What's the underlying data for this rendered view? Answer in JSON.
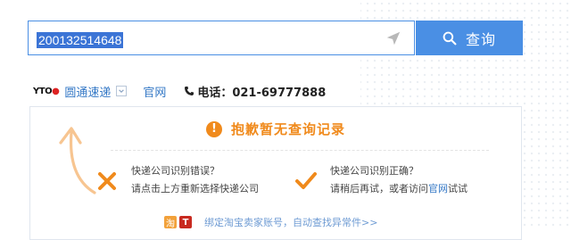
{
  "search": {
    "value": "200132514648",
    "button_label": "查询"
  },
  "carrier": {
    "logo_text": "YTO",
    "name": "圆通速递",
    "official_site": "官网",
    "phone_label": "电话：021-69777888"
  },
  "result": {
    "notice": "抱歉暂无查询记录",
    "wrong_title": "快递公司识别错误？",
    "wrong_action": "请点击上方重新选择快递公司",
    "right_title": "快递公司识别正确？",
    "right_action_prefix": "请稍后再试，或者访问",
    "right_action_link": "官网",
    "right_action_suffix": "试试",
    "footer_taobao_glyph": "淘",
    "footer_tmall_glyph": "T",
    "footer_link": "绑定淘宝卖家账号，自动查找异常件>>"
  },
  "colors": {
    "accent_blue": "#4a8fe4",
    "warning_orange": "#f08a1c"
  }
}
